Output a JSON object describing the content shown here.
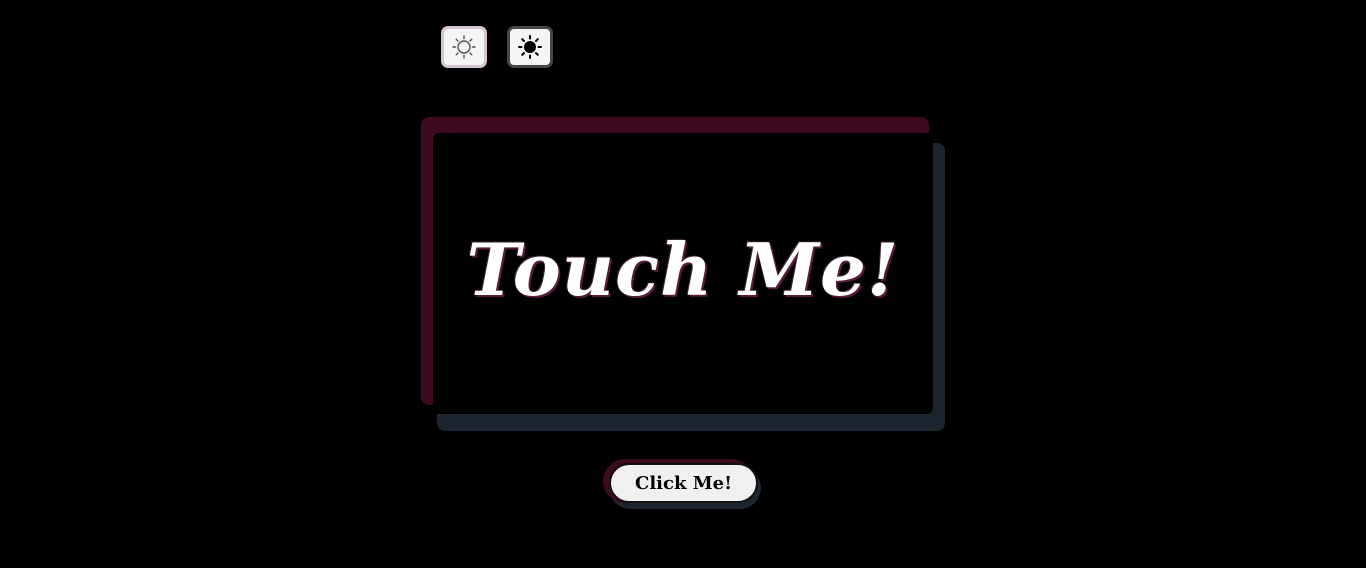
{
  "theme_toggle": {
    "light_icon": "sun-outline-icon",
    "dark_icon": "sun-filled-icon"
  },
  "card": {
    "title": "Touch Me!"
  },
  "button": {
    "label": "Click Me!"
  },
  "colors": {
    "background": "#000000",
    "card_shadow_primary": "#3d0a20",
    "card_shadow_secondary": "#1d2530",
    "text": "#ffffff",
    "button_bg": "#f0f0f0"
  }
}
